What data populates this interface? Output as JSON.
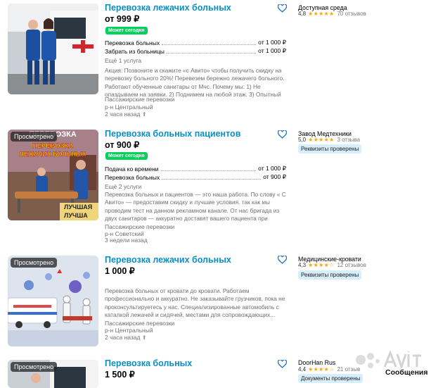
{
  "listings": [
    {
      "viewed": "",
      "title": "Перевозка лежачих больных",
      "price": "от 999 ₽",
      "today": "Может сегодня",
      "services": [
        {
          "name": "Перевозка больных",
          "price": "от 1 000 ₽"
        },
        {
          "name": "Забрать из больницы",
          "price": "от 1 000 ₽"
        }
      ],
      "more": "Ещё 1 услуга",
      "description": "Акция: Позвоните и скажите «с Авито» чтобы получить скидку на перевозку больного 20%! Перевезем бережно лежачего больного. Работают обученные санитары от Мчс. Почему мы: 1) Не опаздываем на заявки. 2) Поднимем на любой этаж. 3) Опытный персонал...",
      "category": "Пассажирские перевозки",
      "district": "р-н Центральный",
      "time": "2 часа назад",
      "seller": "Доступная среда",
      "rating": "4,8",
      "stars": "★★★★★",
      "reviews": "70 отзывов",
      "verified": ""
    },
    {
      "viewed": "Просмотрено",
      "title": "Перевозка больных пациентов",
      "price": "от 900 ₽",
      "today": "Может сегодня",
      "services": [
        {
          "name": "Подача ко времени",
          "price": "от 1 000 ₽"
        },
        {
          "name": "Перевозка больных",
          "price": "от 900 ₽"
        }
      ],
      "more": "Ещё 2 услуги",
      "description": "Перевозка больных и пациентов — это наша работа. По слову « С Авито» — предоставим скидку и лучшие условия. так как мы проводим тест на данном рекламном канале. От нас бригада из двух санитаров — аккуратно доставят вашего пациента при выписки из...",
      "category": "Пассажирские перевозки",
      "district": "р-н Советский",
      "time": "3 недели назад",
      "seller": "Завод Медтехники",
      "rating": "5,0",
      "stars": "★★★★★",
      "reviews": "3 отзыва",
      "verified": "Реквизиты проверены",
      "image_text": [
        "ПЕРЕВОЗКА",
        "ПЕРЕВОЗКА",
        "ЛЕЖАЧИХ БОЛЬНЫХ",
        "ЛУЧШАЯ",
        "ЛУЧША"
      ]
    },
    {
      "viewed": "Просмотрено",
      "title": "Перевозка лежачих больных",
      "price": "1 000 ₽",
      "today": "",
      "services": [],
      "more": "",
      "description": "Перевозка больных от кровати до кровати. Работаем профессионально и аккуратно. Не заказывайте грузчиков, пока не проконсультируетесь у нас. Специализированные автомобиль с каталкой лежачей и сидячей, местами для сопровождающих...",
      "category": "Пассажирские перевозки",
      "district": "р-н Центральный",
      "time": "2 часа назад",
      "seller": "Медицинские-кровати",
      "rating": "4,3",
      "stars": "★★★★☆",
      "reviews": "12 отзывов",
      "verified": "Реквизиты проверены"
    },
    {
      "viewed": "Просмотрено",
      "title": "Перевозка больных",
      "price": "1 500 ₽",
      "seller": "DoorHan Rus",
      "rating": "4,4",
      "stars": "★★★★☆",
      "reviews": "21 отзыв",
      "verified": "Документы проверены"
    }
  ],
  "footer": {
    "messages": "Сообщения"
  },
  "colors": {
    "title": "#0a8ec4",
    "today_badge": "#02d15c",
    "stars": "#f7a600",
    "chip": "#d7eefc"
  }
}
